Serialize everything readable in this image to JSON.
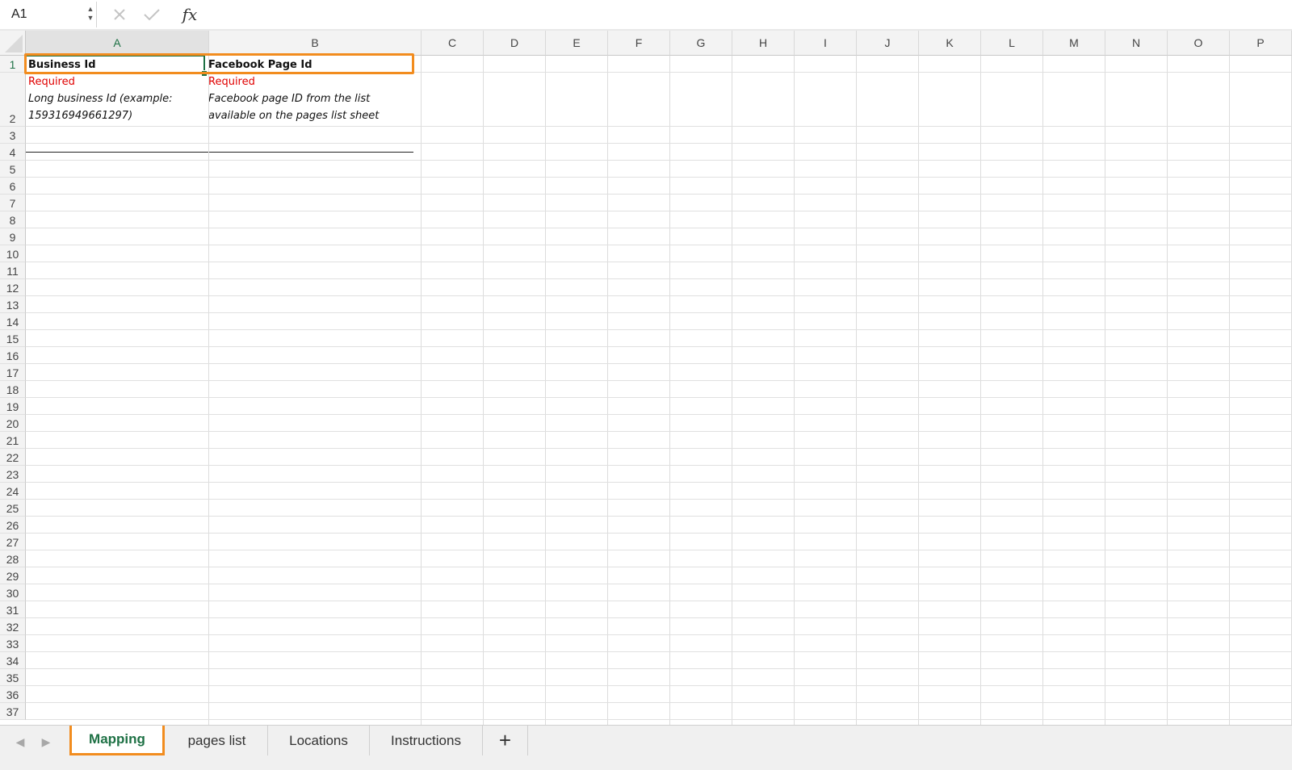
{
  "formula_bar": {
    "name_box": "A1",
    "formula": "",
    "cancel_icon": "close-x-icon",
    "confirm_icon": "checkmark-icon",
    "fx_label": "fx"
  },
  "columns": [
    "A",
    "B",
    "C",
    "D",
    "E",
    "F",
    "G",
    "H",
    "I",
    "J",
    "K",
    "L",
    "M",
    "N",
    "O",
    "P"
  ],
  "active_column": "A",
  "active_row": 1,
  "rows": [
    "1",
    "2",
    "3",
    "4",
    "5",
    "6",
    "7",
    "8",
    "9",
    "10",
    "11",
    "12",
    "13",
    "14",
    "15",
    "16",
    "17",
    "18",
    "19",
    "20",
    "21",
    "22",
    "23",
    "24",
    "25",
    "26",
    "27",
    "28",
    "29",
    "30",
    "31",
    "32",
    "33",
    "34",
    "35",
    "36",
    "37"
  ],
  "cells": {
    "A1": "Business Id",
    "B1": "Facebook Page Id",
    "A2_required": "Required",
    "A2_desc_line1": "Long business Id (example:",
    "A2_desc_line2": "159316949661297)",
    "B2_required": "Required",
    "B2_desc_line1": "Facebook page ID from the list",
    "B2_desc_line2": "available on the pages list sheet"
  },
  "sheet_tabs": [
    {
      "label": "Mapping",
      "active": true
    },
    {
      "label": "pages list",
      "active": false
    },
    {
      "label": "Locations",
      "active": false
    },
    {
      "label": "Instructions",
      "active": false
    }
  ],
  "tab_nav": {
    "prev_icon": "chevron-left-icon",
    "next_icon": "chevron-right-icon",
    "add_icon": "plus-icon",
    "add_label": "+"
  },
  "colors": {
    "accent": "#1e7145",
    "highlight": "#f28c1e",
    "required_text": "#e00000"
  }
}
